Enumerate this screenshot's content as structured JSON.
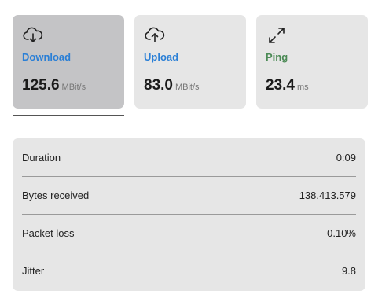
{
  "cards": {
    "download": {
      "label": "Download",
      "value": "125.6",
      "unit": "MBit/s",
      "icon": "cloud-download-icon"
    },
    "upload": {
      "label": "Upload",
      "value": "83.0",
      "unit": "MBit/s",
      "icon": "cloud-upload-icon"
    },
    "ping": {
      "label": "Ping",
      "value": "23.4",
      "unit": "ms",
      "icon": "expand-arrows-icon"
    }
  },
  "colors": {
    "download_label": "#2a7fd6",
    "upload_label": "#2a7fd6",
    "ping_label": "#4b8a55",
    "active_card": "#c4c4c6",
    "card": "#e6e6e6"
  },
  "stats": {
    "duration": {
      "label": "Duration",
      "value": "0:09"
    },
    "bytes_received": {
      "label": "Bytes received",
      "value": "138.413.579"
    },
    "packet_loss": {
      "label": "Packet loss",
      "value": "0.10%"
    },
    "jitter": {
      "label": "Jitter",
      "value": "9.8"
    }
  }
}
